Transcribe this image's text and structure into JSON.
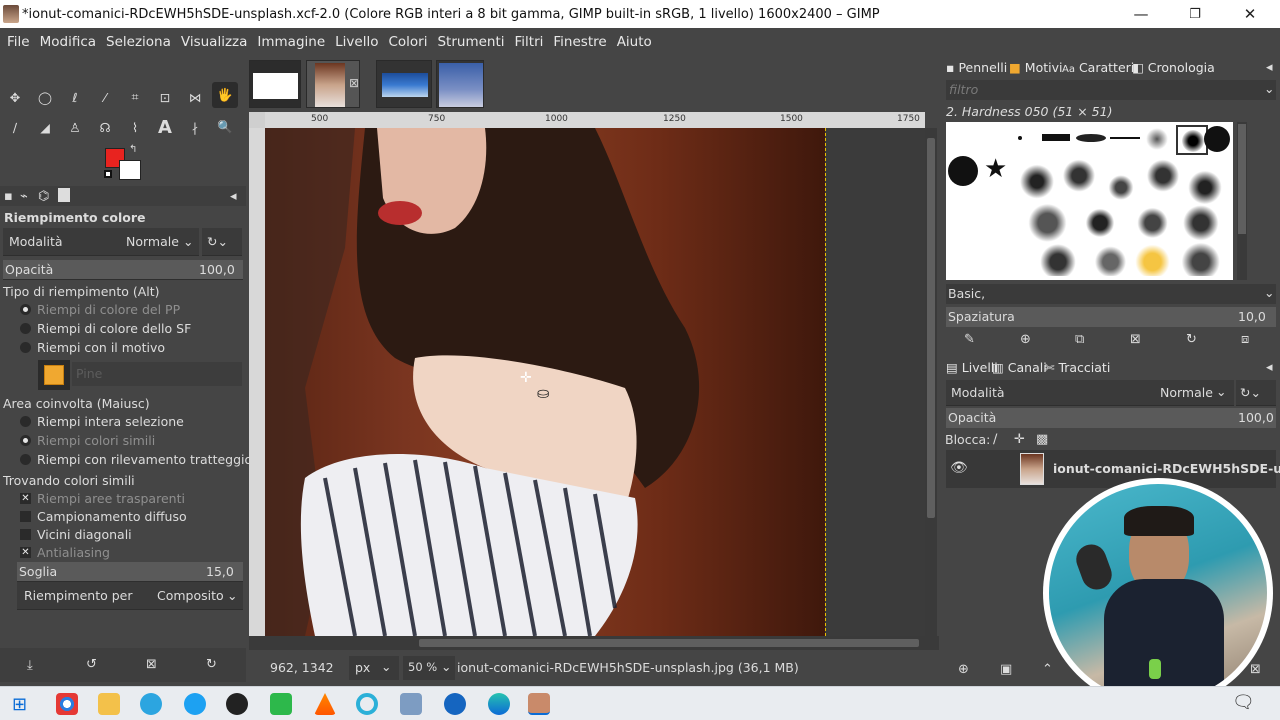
{
  "window": {
    "title": "*ionut-comanici-RDcEWH5hSDE-unsplash.xcf-2.0 (Colore RGB interi a 8 bit gamma, GIMP built-in sRGB, 1 livello) 1600x2400 – GIMP",
    "minimize": "—",
    "maximize": "❐",
    "close": "✕"
  },
  "menu": [
    "File",
    "Modifica",
    "Seleziona",
    "Visualizza",
    "Immagine",
    "Livello",
    "Colori",
    "Strumenti",
    "Filtri",
    "Finestre",
    "Aiuto"
  ],
  "tool_options": {
    "title": "Riempimento colore",
    "mode_label": "Modalità",
    "mode_value": "Normale",
    "opacity_label": "Opacità",
    "opacity_value": "100,0",
    "fill_type_label": "Tipo di riempimento  (Alt)",
    "fill_types": [
      "Riempi di colore del PP",
      "Riempi di colore dello SF",
      "Riempi con il motivo"
    ],
    "pattern_name": "Pine",
    "area_label": "Area coinvolta  (Maiusc)",
    "areas": [
      "Riempi intera selezione",
      "Riempi colori simili",
      "Riempi con rilevamento tratteggio"
    ],
    "similar_label": "Trovando colori simili",
    "similar_opts": [
      "Riempi aree trasparenti",
      "Campionamento diffuso",
      "Vicini diagonali",
      "Antialiasing"
    ],
    "threshold_label": "Soglia",
    "threshold_value": "15,0",
    "fill_by_label": "Riempimento per",
    "fill_by_value": "Composito"
  },
  "colors": {
    "fg": "#e8231f",
    "bg": "#ffffff"
  },
  "ruler_ticks": [
    "500",
    "750",
    "1000",
    "1250",
    "1500",
    "1750"
  ],
  "status": {
    "coords": "962, 1342",
    "unit": "px",
    "zoom": "50 %",
    "file": "ionut-comanici-RDcEWH5hSDE-unsplash.jpg (36,1 MB)"
  },
  "brushes_panel": {
    "tabs": [
      "Pennelli",
      "Motivi",
      "Caratteri",
      "Cronologia"
    ],
    "filter_placeholder": "filtro",
    "brush_name": "2. Hardness 050 (51 × 51)",
    "tag": "Basic,",
    "spacing_label": "Spaziatura",
    "spacing_value": "10,0"
  },
  "layers_panel": {
    "tabs": [
      "Livelli",
      "Canali",
      "Tracciati"
    ],
    "mode_label": "Modalità",
    "mode_value": "Normale",
    "opacity_label": "Opacità",
    "opacity_value": "100,0",
    "lock_label": "Blocca:",
    "layer_name": "ionut-comanici-RDcEWH5hSDE-un"
  }
}
